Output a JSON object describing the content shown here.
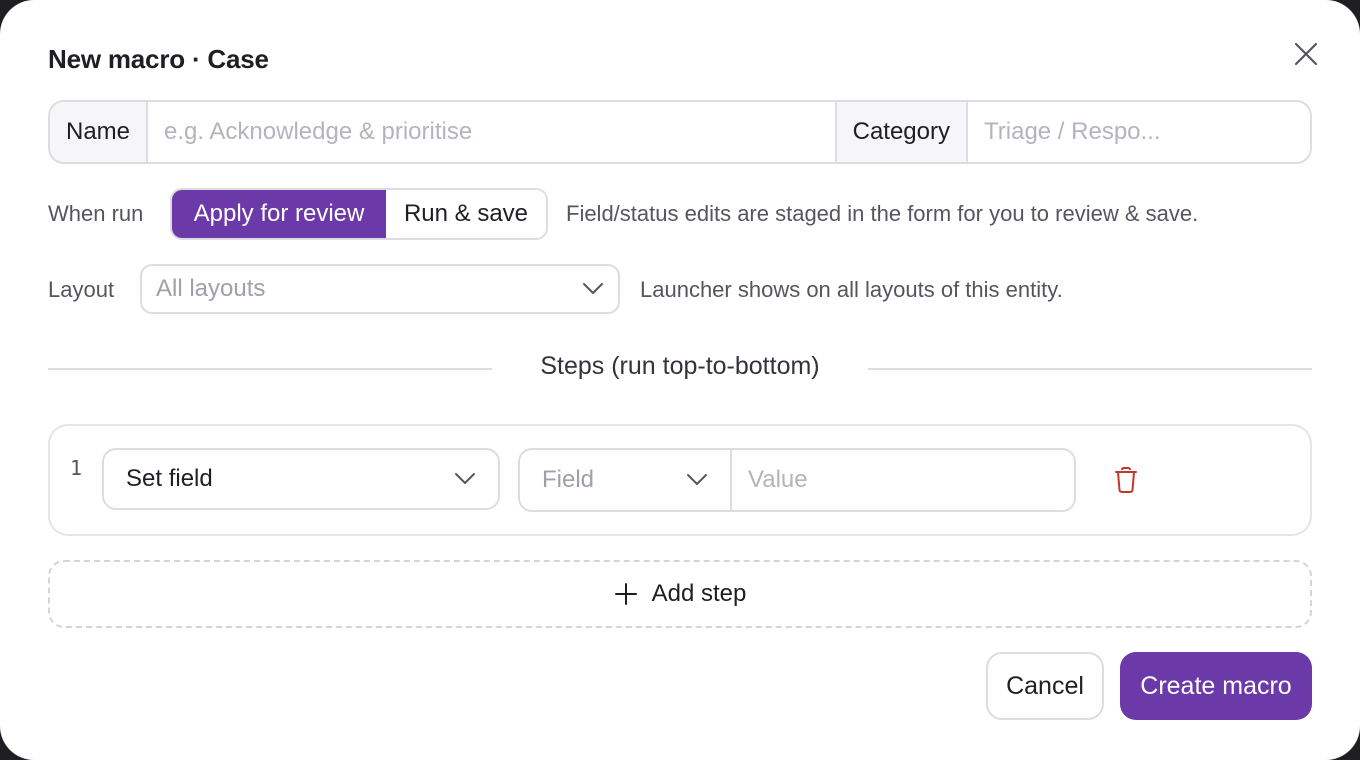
{
  "dialog": {
    "title": "New macro · Case"
  },
  "form": {
    "name_label": "Name",
    "name_placeholder": "e.g. Acknowledge & prioritise",
    "category_label": "Category",
    "category_placeholder": "Triage / Respo...",
    "when_run_label": "When run",
    "when_run_options": [
      "Apply for review",
      "Run & save"
    ],
    "when_run_selected": "Apply for review",
    "when_run_hint": "Field/status edits are staged in the form for you to review & save.",
    "layout_label": "Layout",
    "layout_value": "All layouts",
    "layout_hint": "Launcher shows on all layouts of this entity."
  },
  "steps": {
    "heading": "Steps (run top-to-bottom)",
    "items": [
      {
        "number": "1",
        "action": "Set field",
        "field_placeholder": "Field",
        "value_placeholder": "Value"
      }
    ],
    "add_label": "Add step"
  },
  "footer": {
    "cancel_label": "Cancel",
    "create_label": "Create macro"
  },
  "colors": {
    "accent": "#6b3aa8",
    "danger": "#c0392b",
    "border": "#dcdce2"
  },
  "icons": [
    "close-icon",
    "chevron-down-icon",
    "trash-icon",
    "plus-icon"
  ]
}
